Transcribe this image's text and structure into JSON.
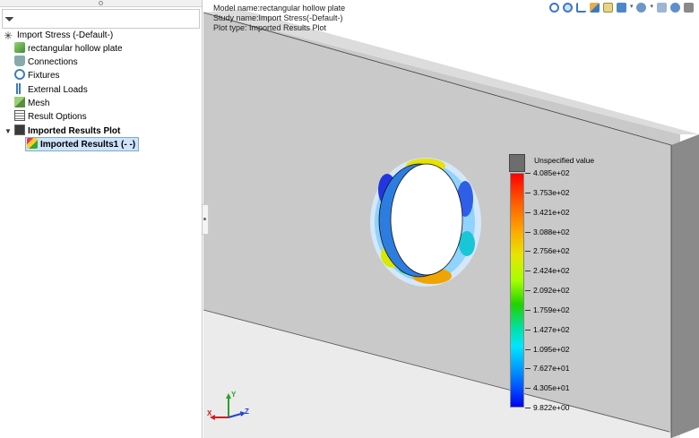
{
  "tree": {
    "root": "Import Stress (-Default-)",
    "items": [
      {
        "label": "rectangular hollow plate",
        "icon": "part-icon"
      },
      {
        "label": "Connections",
        "icon": "connections-icon"
      },
      {
        "label": "Fixtures",
        "icon": "fixtures-icon"
      },
      {
        "label": "External Loads",
        "icon": "external-loads-icon"
      },
      {
        "label": "Mesh",
        "icon": "mesh-icon"
      },
      {
        "label": "Result Options",
        "icon": "result-options-icon"
      },
      {
        "label": "Imported Results Plot",
        "icon": "results-folder-icon"
      },
      {
        "label": "Imported Results1 (- -)",
        "icon": "results-plot-icon"
      }
    ]
  },
  "viewport": {
    "model_name": "Model name:rectangular hollow plate",
    "study_name": "Study name:Import Stress(-Default-)",
    "plot_type": "Plot type: Imported Results Plot",
    "toolbar_icons": [
      "zoom-to-fit-icon",
      "zoom-to-area-icon",
      "previous-view-icon",
      "section-view-icon",
      "dynamic-annotation-icon",
      "view-orientation-icon",
      "display-style-icon",
      "hide-show-items-icon",
      "edit-appearance-icon",
      "apply-scene-icon",
      "view-settings-icon"
    ]
  },
  "legend": {
    "unspecified": "Unspecified value",
    "values": [
      "4.085e+02",
      "3.753e+02",
      "3.421e+02",
      "3.088e+02",
      "2.756e+02",
      "2.424e+02",
      "2.092e+02",
      "1.759e+02",
      "1.427e+02",
      "1.095e+02",
      "7.627e+01",
      "4.305e+01",
      "9.822e+00"
    ],
    "colors": {
      "max": "#ff0000",
      "min": "#0000f0",
      "unspecified": "#6d6d6d"
    }
  },
  "triad": {
    "x": "X",
    "y": "Y",
    "z": "Z"
  }
}
